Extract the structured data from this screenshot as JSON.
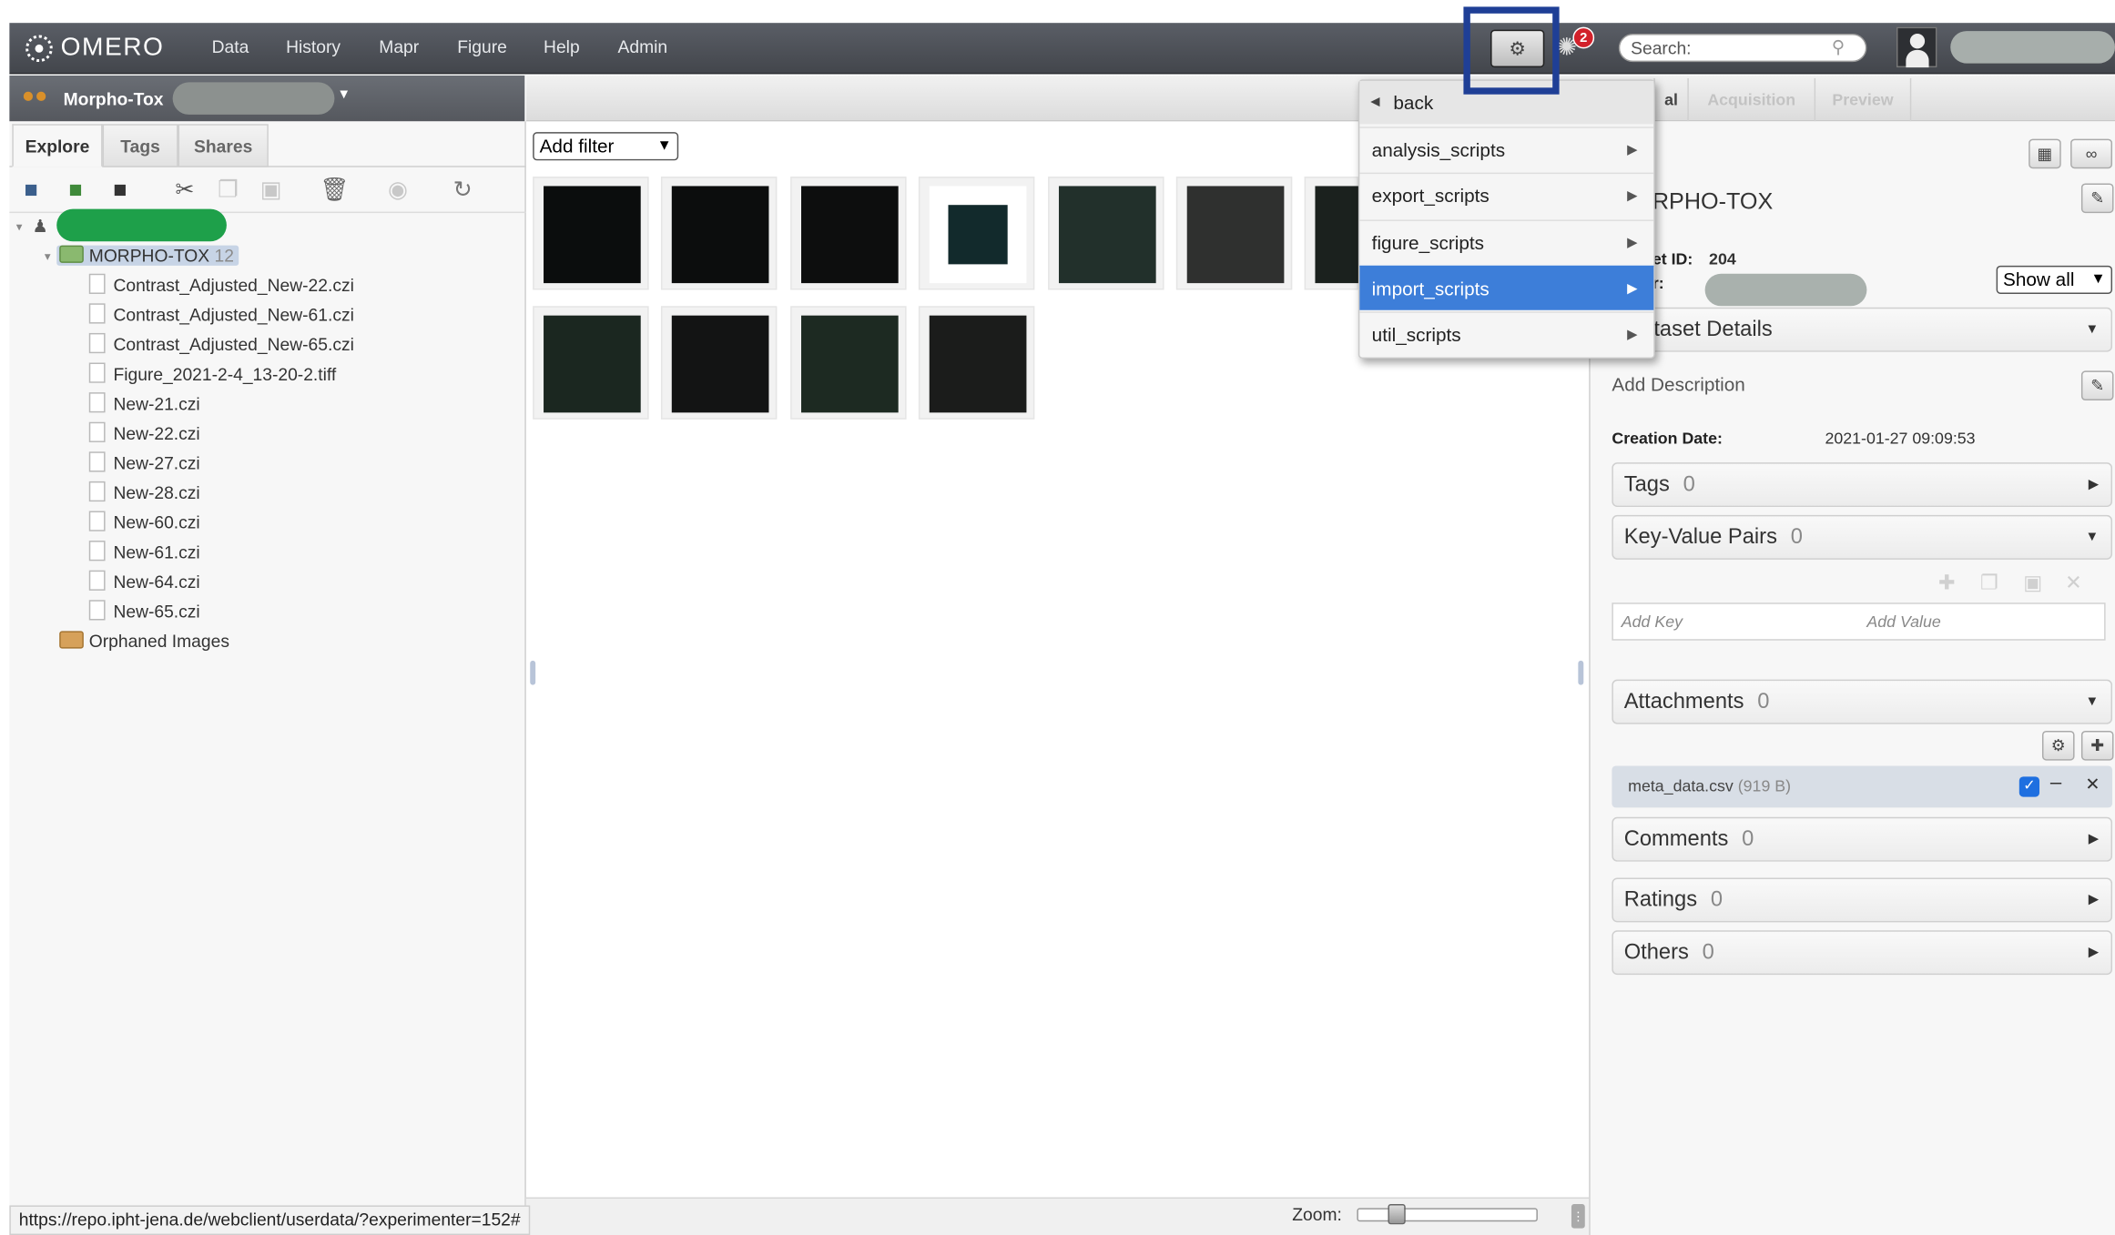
{
  "app": {
    "logo_text": "OMERO",
    "nav": [
      "Data",
      "History",
      "Mapr",
      "Figure",
      "Help",
      "Admin"
    ],
    "search_placeholder": "Search:",
    "activity_badge": "2"
  },
  "group": {
    "name": "Morpho-Tox"
  },
  "left": {
    "tabs": [
      "Explore",
      "Tags",
      "Shares"
    ],
    "dataset": {
      "name": "MORPHO-TOX",
      "count": "12"
    },
    "files": [
      "Contrast_Adjusted_New-22.czi",
      "Contrast_Adjusted_New-61.czi",
      "Contrast_Adjusted_New-65.czi",
      "Figure_2021-2-4_13-20-2.tiff",
      "New-21.czi",
      "New-22.czi",
      "New-27.czi",
      "New-28.czi",
      "New-60.czi",
      "New-61.czi",
      "New-64.czi",
      "New-65.czi"
    ],
    "orphaned": "Orphaned Images"
  },
  "center": {
    "filter_label": "Add filter",
    "zoom_label": "Zoom:",
    "zoom_level": 0.2
  },
  "status_url": "https://repo.ipht-jena.de/webclient/userdata/?experimenter=152#",
  "scripts_menu": {
    "back": "back",
    "items": [
      "analysis_scripts",
      "export_scripts",
      "figure_scripts",
      "import_scripts",
      "util_scripts"
    ],
    "highlighted": "import_scripts"
  },
  "right": {
    "tabs": [
      "al",
      "Acquisition",
      "Preview"
    ],
    "dataset_name": "RPHO-TOX",
    "id_label": "et ID:",
    "id_value": "204",
    "owner_label": "r:",
    "show_all": "Show all",
    "details_header": "taset Details",
    "add_description": "Add Description",
    "creation_label": "Creation Date:",
    "creation_value": "2021-01-27 09:09:53",
    "sections": {
      "tags": {
        "label": "Tags",
        "count": "0"
      },
      "kvp": {
        "label": "Key-Value Pairs",
        "count": "0"
      },
      "attachments": {
        "label": "Attachments",
        "count": "0"
      },
      "comments": {
        "label": "Comments",
        "count": "0"
      },
      "ratings": {
        "label": "Ratings",
        "count": "0"
      },
      "others": {
        "label": "Others",
        "count": "0"
      }
    },
    "add_key": "Add Key",
    "add_value": "Add Value",
    "attachment": {
      "name": "meta_data.csv",
      "size": "(919 B)"
    }
  }
}
